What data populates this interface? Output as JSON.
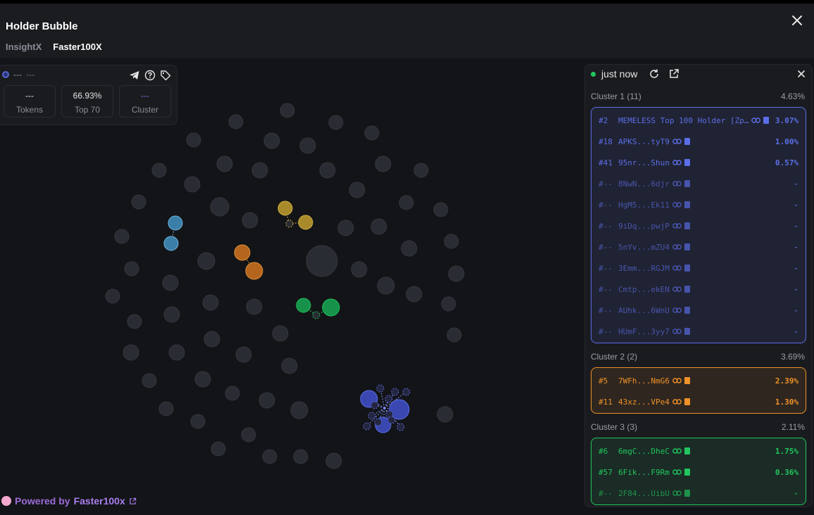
{
  "header": {
    "title": "Holder Bubble",
    "tabs": [
      {
        "label": "InsightX",
        "active": false
      },
      {
        "label": "Faster100X",
        "active": true
      }
    ]
  },
  "stats": {
    "name": "---",
    "symbol": "---",
    "boxes": [
      {
        "value": "---",
        "label": "Tokens"
      },
      {
        "value": "66.93%",
        "label": "Top 70"
      },
      {
        "value": "---",
        "label": "Cluster"
      }
    ]
  },
  "panel": {
    "status": "just now",
    "clusters": [
      {
        "label": "Cluster 1 (11)",
        "pct": "4.63%",
        "color": "#5b6ee8",
        "rows": [
          {
            "rank": "#2",
            "addr": "MEMELESS Top 100 Holder [Zp…",
            "pct": "3.07%"
          },
          {
            "rank": "#18",
            "addr": "APKS...tyT9",
            "pct": "1.00%"
          },
          {
            "rank": "#41",
            "addr": "95nr...Shun",
            "pct": "0.57%"
          },
          {
            "rank": "#--",
            "addr": "8NwN...6djr",
            "pct": "-"
          },
          {
            "rank": "#--",
            "addr": "HgM5...Ek11",
            "pct": "-"
          },
          {
            "rank": "#--",
            "addr": "9iDq...pwjP",
            "pct": "-"
          },
          {
            "rank": "#--",
            "addr": "5nYv...mZU4",
            "pct": "-"
          },
          {
            "rank": "#--",
            "addr": "3Emm...RGJM",
            "pct": "-"
          },
          {
            "rank": "#--",
            "addr": "Cmtp...ekEN",
            "pct": "-"
          },
          {
            "rank": "#--",
            "addr": "AUhk...6WnU",
            "pct": "-"
          },
          {
            "rank": "#--",
            "addr": "HUmF...3yy7",
            "pct": "-"
          }
        ]
      },
      {
        "label": "Cluster 2 (2)",
        "pct": "3.69%",
        "color": "#f0912a",
        "rows": [
          {
            "rank": "#5",
            "addr": "7WFh...NmG6",
            "pct": "2.39%"
          },
          {
            "rank": "#11",
            "addr": "43xz...VPe4",
            "pct": "1.30%"
          }
        ]
      },
      {
        "label": "Cluster 3 (3)",
        "pct": "2.11%",
        "color": "#22c55e",
        "rows": [
          {
            "rank": "#6",
            "addr": "6mgC...DheC",
            "pct": "1.75%"
          },
          {
            "rank": "#57",
            "addr": "6Fik...F9Rm",
            "pct": "0.36%"
          },
          {
            "rank": "#--",
            "addr": "2F84...UibU",
            "pct": "-"
          }
        ]
      }
    ]
  },
  "footer": {
    "powered_prefix": "Powered by",
    "brand": "Faster100x"
  }
}
